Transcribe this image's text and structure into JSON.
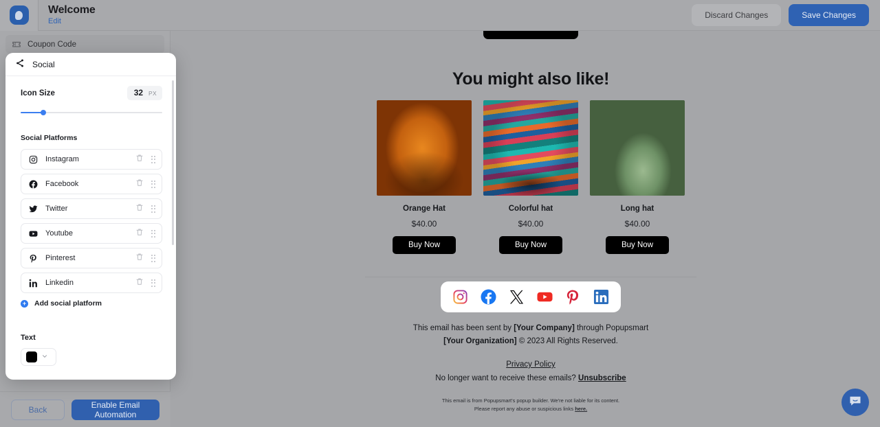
{
  "header": {
    "logo_icon": "popupsmart-logo-icon",
    "title": "Welcome",
    "edit_link": "Edit",
    "discard_label": "Discard Changes",
    "save_label": "Save Changes",
    "accent_color": "#2f62b3"
  },
  "sidebar": {
    "items": [
      {
        "label": "Coupon Code",
        "icon": "ticket-icon"
      }
    ],
    "back_label": "Back",
    "enable_label": "Enable Email Automation"
  },
  "modal": {
    "title": "Social",
    "title_icon": "share-icon",
    "icon_size": {
      "label": "Icon Size",
      "value": "32",
      "unit": "PX",
      "percent": 16
    },
    "platforms_title": "Social Platforms",
    "platforms": [
      {
        "name": "Instagram",
        "icon": "instagram-icon"
      },
      {
        "name": "Facebook",
        "icon": "facebook-icon"
      },
      {
        "name": "Twitter",
        "icon": "twitter-icon"
      },
      {
        "name": "Youtube",
        "icon": "youtube-icon"
      },
      {
        "name": "Pinterest",
        "icon": "pinterest-icon"
      },
      {
        "name": "Linkedin",
        "icon": "linkedin-icon"
      }
    ],
    "add_label": "Add social platform",
    "text_title": "Text",
    "text_color": "#000000"
  },
  "email": {
    "headline": "You might also like!",
    "products": [
      {
        "name": "Orange Hat",
        "price": "$40.00",
        "cta": "Buy Now"
      },
      {
        "name": "Colorful hat",
        "price": "$40.00",
        "cta": "Buy Now"
      },
      {
        "name": "Long hat",
        "price": "$40.00",
        "cta": "Buy Now"
      }
    ],
    "social_icons": [
      "instagram-icon",
      "facebook-icon",
      "x-twitter-icon",
      "youtube-icon",
      "pinterest-icon",
      "linkedin-icon"
    ],
    "sent_by_line1_pre": "This email has been sent by ",
    "sent_by_company": "[Your Company]",
    "sent_by_line1_post": " through Popupsmart",
    "sent_by_org": "[Your Organization]",
    "sent_by_line2_post": " © 2023 All Rights Reserved.",
    "privacy_label": "Privacy Policy",
    "unsub_pre": "No longer want to receive these emails? ",
    "unsub_label": "Unsubscribe",
    "fineprint_line1": "This email is from Popupsmart's popup builder. We're not liable for its content.",
    "fineprint_line2_pre": "Please report any abuse or suspicious links ",
    "fineprint_here": "here."
  },
  "chat": {
    "icon": "chat-bubble-icon"
  }
}
